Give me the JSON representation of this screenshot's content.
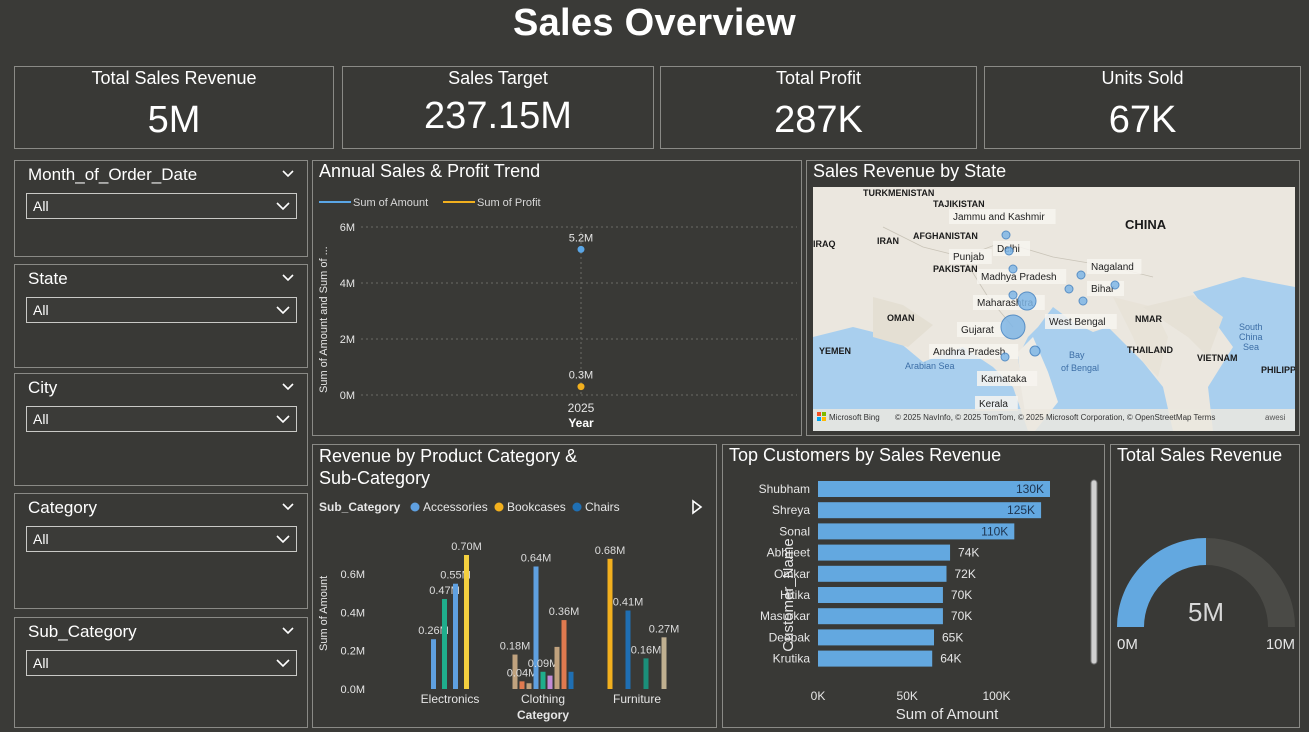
{
  "title": "Sales Overview",
  "kpis": [
    {
      "label": "Total Sales Revenue",
      "value": "5M"
    },
    {
      "label": "Sales Target",
      "value": "237.15M"
    },
    {
      "label": "Total Profit",
      "value": "287K"
    },
    {
      "label": "Units Sold",
      "value": "67K"
    }
  ],
  "slicers": [
    {
      "label": "Month_of_Order_Date",
      "value": "All"
    },
    {
      "label": "State",
      "value": "All"
    },
    {
      "label": "City",
      "value": "All"
    },
    {
      "label": "Category",
      "value": "All"
    },
    {
      "label": "Sub_Category",
      "value": "All"
    }
  ],
  "trend": {
    "title": "Annual Sales & Profit Trend",
    "legend": [
      "Sum of Amount",
      "Sum of Profit"
    ],
    "ylabel": "Sum of Amount and Sum of ...",
    "xlabel": "Year",
    "yticks": [
      "6M",
      "4M",
      "2M",
      "0M"
    ],
    "xtick": "2025"
  },
  "map": {
    "title": "Sales Revenue by State",
    "countries": [
      "TURKMENISTAN",
      "TAJIKISTAN",
      "AFGHANISTAN",
      "IRAN",
      "IRAQ",
      "PAKISTAN",
      "CHINA",
      "OMAN",
      "YEMEN",
      "NMAR",
      "THAILAND",
      "VIETNAM",
      "PHILIPPIN"
    ],
    "states": [
      "Jammu and Kashmir",
      "Delhi",
      "Punjab",
      "Madhya Pradesh",
      "Nagaland",
      "Bihar",
      "Maharashtra",
      "Gujarat",
      "West Bengal",
      "Andhra Pradesh",
      "Karnataka",
      "Kerala"
    ],
    "seas": [
      "Arabian Sea",
      "Bay",
      "of Bengal",
      "South",
      "China",
      "Sea"
    ],
    "attribution": "© 2025 NavInfo, © 2025 TomTom, © 2025 Microsoft Corporation, © OpenStreetMap  Terms",
    "brand": "Microsoft Bing",
    "edge": "awesi"
  },
  "category_chart": {
    "title_line1": "Revenue by Product Category &",
    "title_line2": "Sub-Category",
    "legend_title": "Sub_Category",
    "legend": [
      "Accessories",
      "Bookcases",
      "Chairs"
    ],
    "ylabel": "Sum of Amount",
    "xlabel": "Category",
    "yticks": [
      "0.6M",
      "0.4M",
      "0.2M",
      "0.0M"
    ]
  },
  "customers_chart": {
    "title": "Top Customers by Sales Revenue",
    "ylabel": "Customer_Name",
    "xlabel": "Sum of Amount",
    "xticks": [
      "0K",
      "50K",
      "100K"
    ]
  },
  "gauge": {
    "title": "Total Sales Revenue",
    "value_label": "5M",
    "min_label": "0M",
    "max_label": "10M"
  },
  "chart_data": [
    {
      "type": "scatter",
      "title": "Annual Sales & Profit Trend",
      "xlabel": "Year",
      "ylabel": "Sum of Amount and Sum of ...",
      "x": [
        "2025"
      ],
      "series": [
        {
          "name": "Sum of Amount",
          "values": [
            5.2
          ],
          "labels": [
            "5.2M"
          ],
          "color": "#5aa6e6"
        },
        {
          "name": "Sum of Profit",
          "values": [
            0.3
          ],
          "labels": [
            "0.3M"
          ],
          "color": "#f2b01e"
        }
      ],
      "ylim": [
        0,
        6
      ]
    },
    {
      "type": "bar",
      "title": "Revenue by Product Category & Sub-Category",
      "xlabel": "Category",
      "ylabel": "Sum of Amount",
      "ylim": [
        0,
        0.7
      ],
      "groups": [
        {
          "category": "Electronics",
          "bars": [
            {
              "value": 0.26,
              "label": "0.26M",
              "color": "#5fa0e0"
            },
            {
              "value": 0.47,
              "label": "0.47M",
              "color": "#1fae8c"
            },
            {
              "value": 0.55,
              "label": "0.55M",
              "color": "#5fa0e0"
            },
            {
              "value": 0.7,
              "label": "0.70M",
              "color": "#f4d03f"
            }
          ]
        },
        {
          "category": "Clothing",
          "bars": [
            {
              "value": 0.18,
              "label": "0.18M",
              "color": "#c0a27e"
            },
            {
              "value": 0.04,
              "label": "0.04M",
              "color": "#e07a4f"
            },
            {
              "value": 0.03,
              "label": "",
              "color": "#c0a27e"
            },
            {
              "value": 0.64,
              "label": "0.64M",
              "color": "#5fa0e0"
            },
            {
              "value": 0.09,
              "label": "0.09M",
              "color": "#1fae8c"
            },
            {
              "value": 0.07,
              "label": "",
              "color": "#c38bd6"
            },
            {
              "value": 0.22,
              "label": "",
              "color": "#c0a27e"
            },
            {
              "value": 0.36,
              "label": "0.36M",
              "color": "#e07a4f"
            },
            {
              "value": 0.09,
              "label": "",
              "color": "#1f6fb3"
            }
          ]
        },
        {
          "category": "Furniture",
          "bars": [
            {
              "value": 0.68,
              "label": "0.68M",
              "color": "#f2b01e"
            },
            {
              "value": 0.41,
              "label": "0.41M",
              "color": "#1f6fb3"
            },
            {
              "value": 0.16,
              "label": "0.16M",
              "color": "#1b8f7a"
            },
            {
              "value": 0.27,
              "label": "0.27M",
              "color": "#c0b090"
            }
          ]
        }
      ]
    },
    {
      "type": "bar",
      "orientation": "horizontal",
      "title": "Top Customers by Sales Revenue",
      "xlabel": "Sum of Amount",
      "ylabel": "Customer_Name",
      "xlim": [
        0,
        130
      ],
      "categories": [
        "Shubham",
        "Shreya",
        "Sonal",
        "Abhijeet",
        "Omkar",
        "Hitika",
        "Masurkar",
        "Deepak",
        "Krutika"
      ],
      "values": [
        130,
        125,
        110,
        74,
        72,
        70,
        70,
        65,
        64
      ],
      "labels": [
        "130K",
        "125K",
        "110K",
        "74K",
        "72K",
        "70K",
        "70K",
        "65K",
        "64K"
      ],
      "color": "#63a8e0"
    },
    {
      "type": "gauge",
      "title": "Total Sales Revenue",
      "value": 5,
      "min": 0,
      "max": 10,
      "color": "#63a8e0"
    }
  ]
}
